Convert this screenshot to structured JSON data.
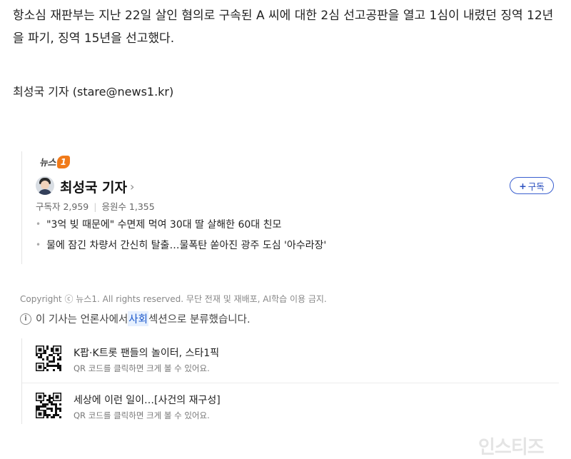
{
  "article": {
    "paragraph": "항소심 재판부는 지난 22일 살인 혐의로 구속된 A 씨에 대한 2심 선고공판을 열고 1심이 내렸던 징역 12년을 파기, 징역 15년을 선고했다.",
    "byline": "최성국 기자 (stare@news1.kr)"
  },
  "reporter_card": {
    "logo_text": "뉴스",
    "logo_mark": "1",
    "reporter_name": "최성국 기자",
    "chevron": "›",
    "subscribe_plus": "+",
    "subscribe_label": "구독",
    "subscribers": "구독자 2,959",
    "separator": "|",
    "supporters": "응원수 1,355",
    "headlines": [
      "\"3억 빚 때문에\" 수면제 먹여 30대 딸 살해한 60대 친모",
      "물에 잠긴 차량서 간신히 탈출…물폭탄 쏟아진 광주 도심 '아수라장'"
    ]
  },
  "footer": {
    "copyright": "Copyright ⓒ 뉴스1. All rights reserved. 무단 전재 및 재배포, AI학습 이용 금지.",
    "info_icon": "i",
    "notice_prefix": "이 기사는 언론사에서 ",
    "notice_section": "사회",
    "notice_suffix": " 섹션으로 분류했습니다."
  },
  "qr_promos": [
    {
      "title": "K팝·K트롯 팬들의 놀이터, 스타1픽",
      "subtitle": "QR 코드를 클릭하면 크게 볼 수 있어요."
    },
    {
      "title": "세상에 이런 일이…[사건의 재구성]",
      "subtitle": "QR 코드를 클릭하면 크게 볼 수 있어요."
    }
  ],
  "watermark": "인스티즈",
  "colors": {
    "accent_orange": "#f07a1a",
    "subscribe_blue": "#2a4fbf",
    "highlight_bg": "#e6f0ff"
  }
}
